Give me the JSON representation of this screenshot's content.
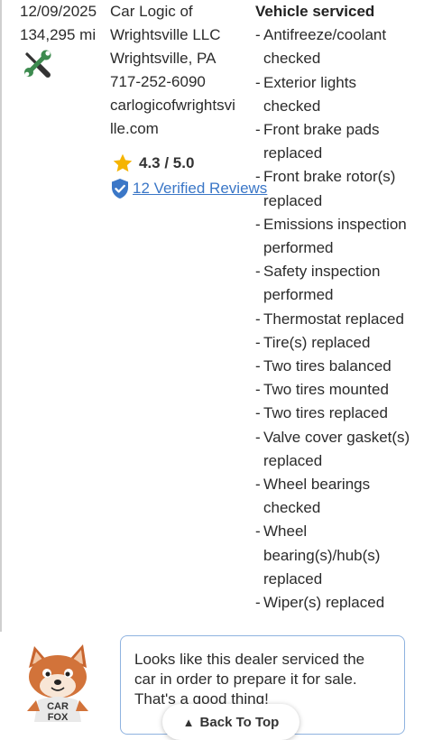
{
  "record": {
    "date": "12/09/2025",
    "mileage": "134,295 mi",
    "icon": "wrench-screwdriver-icon"
  },
  "shop": {
    "name_line1": "Car Logic of",
    "name_line2": "Wrightsville LLC",
    "location": "Wrightsville, PA",
    "phone": "717-252-6090",
    "website_line1": "carlogicofwrightsvi",
    "website_line2": "lle.com",
    "rating": "4.3 / 5.0",
    "reviews_link": "12 Verified Reviews"
  },
  "services": {
    "title": "Vehicle serviced",
    "items": [
      [
        "Antifreeze/coolant",
        "checked"
      ],
      [
        "Exterior lights",
        "checked"
      ],
      [
        "Front brake pads",
        "replaced"
      ],
      [
        "Front brake rotor(s)",
        "replaced"
      ],
      [
        "Emissions inspection",
        "performed"
      ],
      [
        "Safety inspection",
        "performed"
      ],
      [
        "Thermostat replaced"
      ],
      [
        "Tire(s) replaced"
      ],
      [
        "Two tires balanced"
      ],
      [
        "Two tires mounted"
      ],
      [
        "Two tires replaced"
      ],
      [
        "Valve cover gasket(s)",
        "replaced"
      ],
      [
        "Wheel bearings",
        "checked"
      ],
      [
        "Wheel",
        "bearing(s)/hub(s)",
        "replaced"
      ],
      [
        "Wiper(s) replaced"
      ]
    ]
  },
  "callout": {
    "text_line1": "Looks like this dealer serviced the",
    "text_line2": "car in order to prepare it for sale.",
    "text_line3": "That's a good thing!",
    "mascot_shirt_line1": "CAR",
    "mascot_shirt_line2": "FOX"
  },
  "back_to_top": {
    "label": "Back To Top"
  },
  "colors": {
    "link": "#3b77c7",
    "star": "#f5b400",
    "shield": "#3b77c7",
    "bubble_border": "#8fb3e0",
    "wrench_green": "#3d8b4f"
  }
}
